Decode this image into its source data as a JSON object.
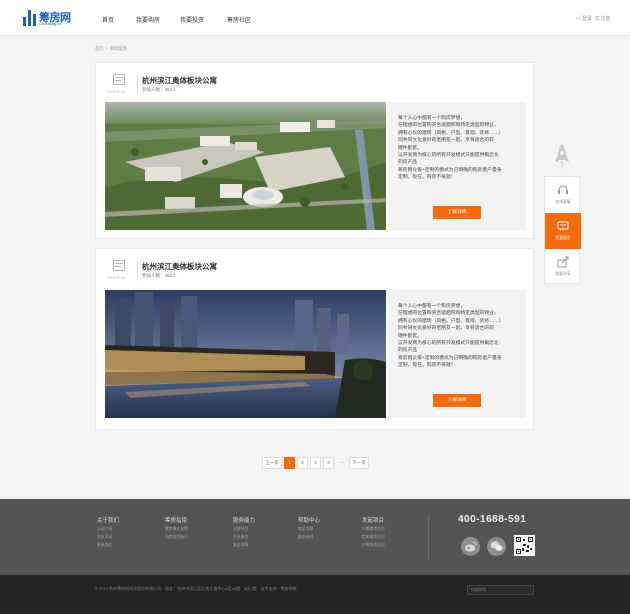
{
  "header": {
    "logo_text": "筹房网",
    "logo_sub": "Choufang.cn",
    "nav": [
      "首页",
      "我要购房",
      "我要投资",
      "筹房社区"
    ],
    "login": "登录",
    "register": "注册"
  },
  "breadcrumb": "首页 > 项目案例",
  "cards": [
    {
      "date": "2016-07-16",
      "title": "杭州滨江奥体板块公寓",
      "meta": "参加人数：452人",
      "desc": [
        "每个人心中都有一个购房梦想，",
        "在理想的位置购买合适面积和特定类型的物业，",
        "拥有心仪的建筑（风格、户型、景观、装修……）",
        "同共同文化爱好的老朋友一起，享有适合的软",
        "硬件配套。",
        "以开发商为核心的所有开发模式只能提供概念化",
        "的房产品",
        "筹房网众筹+定制的模式为已明确的购房者户量身",
        "定制，现在，购房不将就！"
      ],
      "button": "了解详情"
    },
    {
      "date": "2016-07-16",
      "title": "杭州滨江奥体板块公寓",
      "meta": "参加人数：452人",
      "desc": [
        "每个人心中都有一个购房梦想，",
        "在理想的位置购买合适面积和特定类型的物业，",
        "拥有心仪的建筑（风格、户型、景观、装修……）",
        "同共同文化爱好的老朋友一起，享有适合的软",
        "硬件配套。",
        "以开发商为核心的所有开发模式只能提供概念化",
        "的房产品",
        "筹房网众筹+定制的模式为已明确的购房者户量身",
        "定制，现在，购房不将就！"
      ],
      "button": "了解详情"
    }
  ],
  "pager": {
    "prev": "上一页",
    "pages": [
      "1",
      "2",
      "3",
      "4"
    ],
    "ellipsis": "...",
    "next": "下一页",
    "current": "1"
  },
  "floater": [
    "在线客服",
    "我要留言",
    "我要分享"
  ],
  "footer": {
    "columns": [
      {
        "title": "关于我们",
        "items": [
          "公司介绍",
          "团队风采",
          "联系我们"
        ]
      },
      {
        "title": "筹房指南",
        "items": [
          "筹房模式说明",
          "购房投资指引"
        ]
      },
      {
        "title": "服务能力",
        "items": [
          "自营项目",
          "平台服务",
          "安全保障"
        ]
      },
      {
        "title": "帮助中心",
        "items": [
          "常见问题",
          "服务说明"
        ]
      },
      {
        "title": "发起项目",
        "items": [
          "众筹建房项目",
          "定制建房项目",
          "众筹购房项目"
        ]
      }
    ],
    "phone": "400-1688-591"
  },
  "bottom": {
    "copyright": "© 2015 杭州筹房网科技股份有限公司　地址：杭州市滨江区江南大道中心A区05楼　8区0楼　技术支持：筹房网络",
    "search_placeholder": "快捷搜索"
  },
  "colors": {
    "accent": "#f76b0a",
    "brand": "#1d5fb8"
  }
}
